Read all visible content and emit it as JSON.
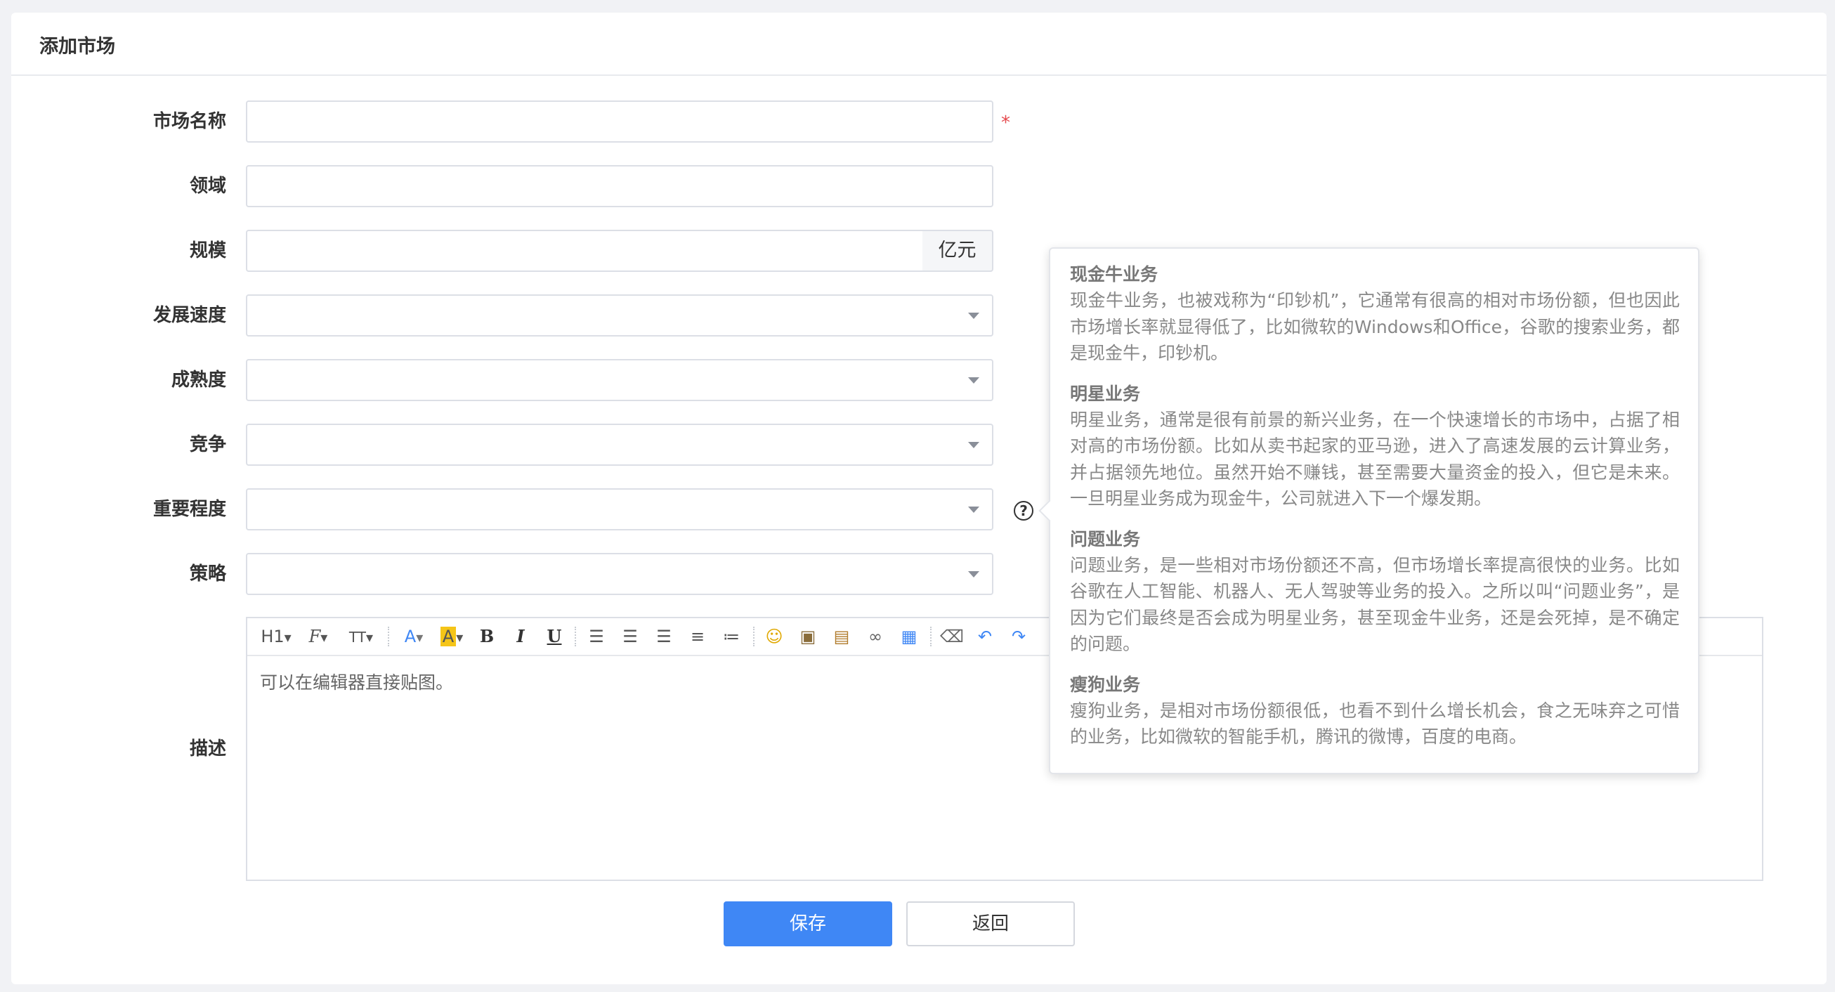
{
  "page": {
    "title": "添加市场"
  },
  "form": {
    "name_label": "市场名称",
    "required_mark": "*",
    "domain_label": "领域",
    "scale_label": "规模",
    "scale_unit": "亿元",
    "growth_label": "发展速度",
    "maturity_label": "成熟度",
    "competition_label": "竞争",
    "importance_label": "重要程度",
    "strategy_label": "策略",
    "description_label": "描述",
    "help_icon": "?"
  },
  "editor": {
    "placeholder": "可以在编辑器直接贴图。",
    "toolbar": {
      "heading": "H1",
      "font_family": "F",
      "font_size": "TT",
      "font_color": "A",
      "highlight": "A",
      "bold": "B",
      "italic": "I",
      "underline": "U"
    }
  },
  "tooltip": {
    "sections": [
      {
        "title": "现金牛业务",
        "text": "现金牛业务，也被戏称为“印钞机”，它通常有很高的相对市场份额，但也因此市场增长率就显得低了，比如微软的Windows和Office，谷歌的搜索业务，都是现金牛，印钞机。"
      },
      {
        "title": "明星业务",
        "text": "明星业务，通常是很有前景的新兴业务，在一个快速增长的市场中，占据了相对高的市场份额。比如从卖书起家的亚马逊，进入了高速发展的云计算业务，并占据领先地位。虽然开始不赚钱，甚至需要大量资金的投入，但它是未来。一旦明星业务成为现金牛，公司就进入下一个爆发期。"
      },
      {
        "title": "问题业务",
        "text": "问题业务，是一些相对市场份额还不高，但市场增长率提高很快的业务。比如谷歌在人工智能、机器人、无人驾驶等业务的投入。之所以叫“问题业务”，是因为它们最终是否会成为明星业务，甚至现金牛业务，还是会死掉，是不确定的问题。"
      },
      {
        "title": "瘦狗业务",
        "text": "瘦狗业务，是相对市场份额很低，也看不到什么增长机会，食之无味弃之可惜的业务，比如微软的智能手机，腾讯的微博，百度的电商。"
      }
    ]
  },
  "buttons": {
    "save": "保存",
    "back": "返回"
  },
  "colors": {
    "primary": "#3f87f5",
    "required": "#e5484d",
    "border": "#dcdfe6",
    "background": "#f1f2f5"
  }
}
